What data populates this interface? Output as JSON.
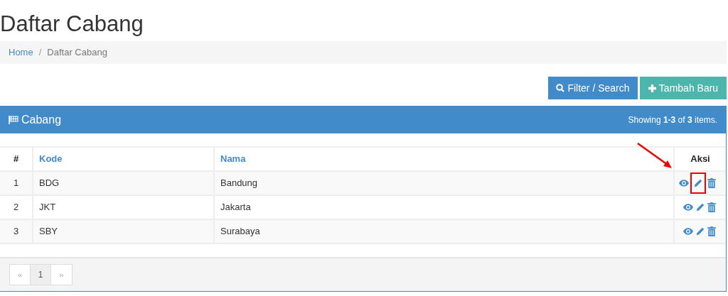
{
  "page_title": "Daftar Cabang",
  "breadcrumb": [
    {
      "label": "Home",
      "link": true
    },
    {
      "label": "Daftar Cabang",
      "link": false
    }
  ],
  "separator": "/",
  "buttons": [
    {
      "kind": "filter",
      "label": "Filter / Search"
    },
    {
      "kind": "add",
      "label": "Tambah Baru"
    }
  ],
  "panel": {
    "title": "Cabang",
    "summary": "Showing **1-3** of **3** items."
  },
  "table": {
    "columns": [
      {
        "label": "#",
        "sortable": false
      },
      {
        "label": "Kode",
        "sortable": true
      },
      {
        "label": "Nama",
        "sortable": true
      },
      {
        "label": "Aksi",
        "sortable": false
      }
    ],
    "rows": [
      {
        "no": "1",
        "kode": "BDG",
        "nama": "Bandung",
        "edit_marked": true
      },
      {
        "no": "2",
        "kode": "JKT",
        "nama": "Jakarta",
        "edit_marked": false
      },
      {
        "no": "3",
        "kode": "SBY",
        "nama": "Surabaya",
        "edit_marked": false
      }
    ]
  },
  "pagination": [
    {
      "label": "«",
      "kind": "prev",
      "selected": false
    },
    {
      "label": "1",
      "kind": "page",
      "selected": true
    },
    {
      "label": "»",
      "kind": "next",
      "selected": false
    }
  ]
}
